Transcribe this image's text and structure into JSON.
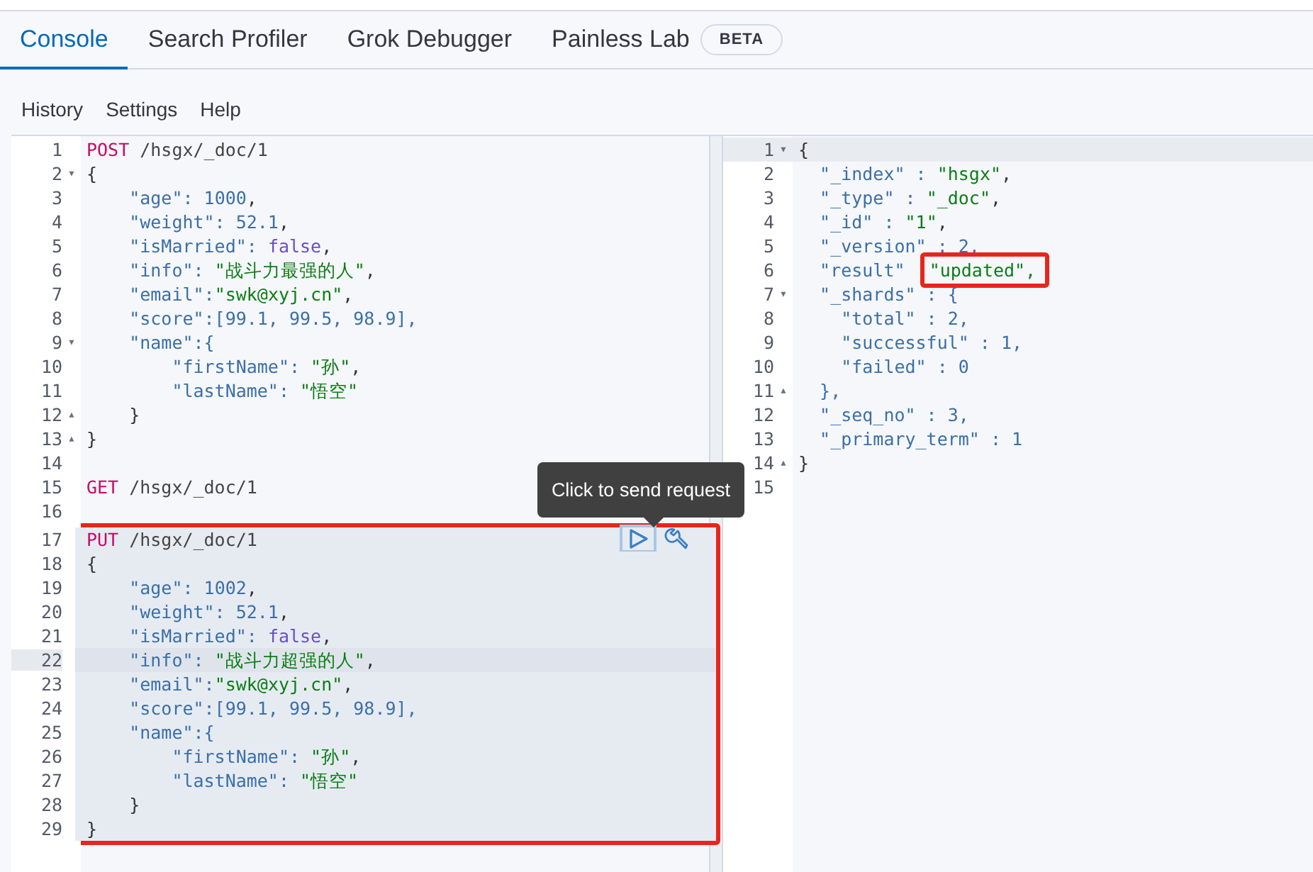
{
  "tabs": [
    {
      "label": "Console",
      "selected": true
    },
    {
      "label": "Search Profiler",
      "selected": false
    },
    {
      "label": "Grok Debugger",
      "selected": false
    },
    {
      "label": "Painless Lab",
      "selected": false,
      "badge": "BETA"
    }
  ],
  "menu": [
    "History",
    "Settings",
    "Help"
  ],
  "request_editor": {
    "lines": [
      {
        "n": "1",
        "tokens": [
          {
            "kind": "method",
            "text": "POST"
          },
          {
            "kind": "path",
            "text": " /hsgx/_doc/1"
          }
        ]
      },
      {
        "n": "2",
        "fold": "▾",
        "tokens": [
          {
            "kind": "punct",
            "text": "{"
          }
        ]
      },
      {
        "n": "3",
        "tokens": [
          {
            "kind": "key",
            "text": "    \"age\": "
          },
          {
            "kind": "number",
            "text": "1000"
          },
          {
            "kind": "punct",
            "text": ","
          }
        ]
      },
      {
        "n": "4",
        "tokens": [
          {
            "kind": "key",
            "text": "    \"weight\": "
          },
          {
            "kind": "number",
            "text": "52.1"
          },
          {
            "kind": "punct",
            "text": ","
          }
        ]
      },
      {
        "n": "5",
        "tokens": [
          {
            "kind": "key",
            "text": "    \"isMarried\": "
          },
          {
            "kind": "bool",
            "text": "false"
          },
          {
            "kind": "punct",
            "text": ","
          }
        ]
      },
      {
        "n": "6",
        "tokens": [
          {
            "kind": "key",
            "text": "    \"info\": "
          },
          {
            "kind": "string",
            "text": "\"战斗力最强的人\""
          },
          {
            "kind": "punct",
            "text": ","
          }
        ]
      },
      {
        "n": "7",
        "tokens": [
          {
            "kind": "key",
            "text": "    \"email\":"
          },
          {
            "kind": "string",
            "text": "\"swk@xyj.cn\""
          },
          {
            "kind": "punct",
            "text": ","
          }
        ]
      },
      {
        "n": "8",
        "tokens": [
          {
            "kind": "key",
            "text": "    \"score\":[99.1, 99.5, 98.9],"
          }
        ]
      },
      {
        "n": "9",
        "fold": "▾",
        "tokens": [
          {
            "kind": "key",
            "text": "    \"name\":{"
          }
        ]
      },
      {
        "n": "10",
        "tokens": [
          {
            "kind": "key",
            "text": "        \"firstName\": "
          },
          {
            "kind": "string",
            "text": "\"孙\""
          },
          {
            "kind": "punct",
            "text": ","
          }
        ]
      },
      {
        "n": "11",
        "tokens": [
          {
            "kind": "key",
            "text": "        \"lastName\": "
          },
          {
            "kind": "string",
            "text": "\"悟空\""
          }
        ]
      },
      {
        "n": "12",
        "fold": "▴",
        "tokens": [
          {
            "kind": "punct",
            "text": "    }"
          }
        ]
      },
      {
        "n": "13",
        "fold": "▴",
        "tokens": [
          {
            "kind": "punct",
            "text": "}"
          }
        ]
      },
      {
        "n": "14"
      },
      {
        "n": "15",
        "tokens": [
          {
            "kind": "method",
            "text": "GET"
          },
          {
            "kind": "path",
            "text": " /hsgx/_doc/1"
          }
        ]
      },
      {
        "n": "16"
      },
      {
        "n": "17",
        "marked": true,
        "actions": [
          {
            "kind": "send",
            "focused": true,
            "tooltip": "Click to send request"
          },
          {
            "kind": "wrench",
            "focused": false
          }
        ],
        "tokens": [
          {
            "kind": "method",
            "text": "PUT"
          },
          {
            "kind": "path",
            "text": " /hsgx/_doc/1"
          }
        ]
      },
      {
        "n": "18",
        "marked": true,
        "tokens": [
          {
            "kind": "punct",
            "text": "{"
          }
        ]
      },
      {
        "n": "19",
        "marked": true,
        "tokens": [
          {
            "kind": "key",
            "text": "    \"age\": "
          },
          {
            "kind": "number",
            "text": "1002"
          },
          {
            "kind": "punct",
            "text": ","
          }
        ]
      },
      {
        "n": "20",
        "marked": true,
        "tokens": [
          {
            "kind": "key",
            "text": "    \"weight\": "
          },
          {
            "kind": "number",
            "text": "52.1"
          },
          {
            "kind": "punct",
            "text": ","
          }
        ]
      },
      {
        "n": "21",
        "marked": true,
        "tokens": [
          {
            "kind": "key",
            "text": "    \"isMarried\": "
          },
          {
            "kind": "bool",
            "text": "false"
          },
          {
            "kind": "punct",
            "text": ","
          }
        ]
      },
      {
        "n": "22",
        "marked": true,
        "active": true,
        "tokens": [
          {
            "kind": "key",
            "text": "    \"info\": "
          },
          {
            "kind": "string",
            "text": "\"战斗力超强的人\""
          },
          {
            "kind": "punct",
            "text": ","
          }
        ]
      },
      {
        "n": "23",
        "marked": true,
        "tokens": [
          {
            "kind": "key",
            "text": "    \"email\":"
          },
          {
            "kind": "string",
            "text": "\"swk@xyj.cn\""
          },
          {
            "kind": "punct",
            "text": ","
          }
        ]
      },
      {
        "n": "24",
        "marked": true,
        "tokens": [
          {
            "kind": "key",
            "text": "    \"score\":[99.1, 99.5, 98.9],"
          }
        ]
      },
      {
        "n": "25",
        "marked": true,
        "tokens": [
          {
            "kind": "key",
            "text": "    \"name\":{"
          }
        ]
      },
      {
        "n": "26",
        "marked": true,
        "tokens": [
          {
            "kind": "key",
            "text": "        \"firstName\": "
          },
          {
            "kind": "string",
            "text": "\"孙\""
          },
          {
            "kind": "punct",
            "text": ","
          }
        ]
      },
      {
        "n": "27",
        "marked": true,
        "tokens": [
          {
            "kind": "key",
            "text": "        \"lastName\": "
          },
          {
            "kind": "string",
            "text": "\"悟空\""
          }
        ]
      },
      {
        "n": "28",
        "marked": true,
        "tokens": [
          {
            "kind": "punct",
            "text": "    }"
          }
        ]
      },
      {
        "n": "29",
        "marked": true,
        "tokens": [
          {
            "kind": "punct",
            "text": "}"
          }
        ]
      }
    ]
  },
  "response_viewer": {
    "lines": [
      {
        "n": "1",
        "fold": "▾",
        "active": true,
        "tokens": [
          {
            "kind": "punct",
            "text": "{"
          }
        ]
      },
      {
        "n": "2",
        "tokens": [
          {
            "kind": "key",
            "text": "  \"_index\" : "
          },
          {
            "kind": "string",
            "text": "\"hsgx\""
          },
          {
            "kind": "punct",
            "text": ","
          }
        ]
      },
      {
        "n": "3",
        "tokens": [
          {
            "kind": "key",
            "text": "  \"_type\" : "
          },
          {
            "kind": "string",
            "text": "\"_doc\""
          },
          {
            "kind": "punct",
            "text": ","
          }
        ]
      },
      {
        "n": "4",
        "tokens": [
          {
            "kind": "key",
            "text": "  \"_id\" : "
          },
          {
            "kind": "string",
            "text": "\"1\""
          },
          {
            "kind": "punct",
            "text": ","
          }
        ]
      },
      {
        "n": "5",
        "tokens": [
          {
            "kind": "key",
            "text": "  \"_version\" : 2,"
          }
        ]
      },
      {
        "n": "6",
        "tokens": [
          {
            "kind": "key",
            "text": "  \"result\"  "
          },
          {
            "kind": "string",
            "text": "\"updated\",",
            "boxed": true
          }
        ]
      },
      {
        "n": "7",
        "fold": "▾",
        "tokens": [
          {
            "kind": "key",
            "text": "  \"_shards\" : {"
          }
        ]
      },
      {
        "n": "8",
        "tokens": [
          {
            "kind": "key",
            "text": "    \"total\" : 2,"
          }
        ]
      },
      {
        "n": "9",
        "tokens": [
          {
            "kind": "key",
            "text": "    \"successful\" : 1,"
          }
        ]
      },
      {
        "n": "10",
        "tokens": [
          {
            "kind": "key",
            "text": "    \"failed\" : 0"
          }
        ]
      },
      {
        "n": "11",
        "fold": "▴",
        "tokens": [
          {
            "kind": "key",
            "text": "  },"
          }
        ]
      },
      {
        "n": "12",
        "tokens": [
          {
            "kind": "key",
            "text": "  \"_seq_no\" : 3,"
          }
        ]
      },
      {
        "n": "13",
        "tokens": [
          {
            "kind": "key",
            "text": "  \"_primary_term\" : 1"
          }
        ]
      },
      {
        "n": "14",
        "fold": "▴",
        "tokens": [
          {
            "kind": "punct",
            "text": "}"
          }
        ]
      },
      {
        "n": "15"
      }
    ]
  }
}
